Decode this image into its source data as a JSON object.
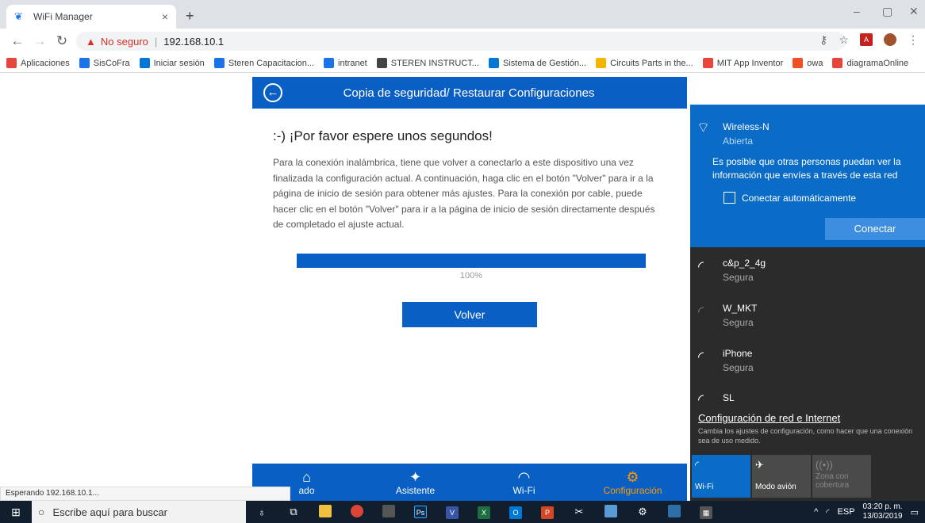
{
  "browser": {
    "tab_title": "WiFi Manager",
    "tab_close": "×",
    "new_tab": "+",
    "security_label": "No seguro",
    "url": "192.168.10.1",
    "window_controls": [
      "–",
      "▢",
      "✕"
    ]
  },
  "bookmarks": [
    {
      "label": "Aplicaciones",
      "color": "#e8453c"
    },
    {
      "label": "SisCoFra",
      "color": "#1a73e8"
    },
    {
      "label": "Iniciar sesión",
      "color": "#0078d4"
    },
    {
      "label": "Steren Capacitacion...",
      "color": "#1a73e8"
    },
    {
      "label": "intranet",
      "color": "#1a73e8"
    },
    {
      "label": "STEREN INSTRUCT...",
      "color": "#444"
    },
    {
      "label": "Sistema de Gestión...",
      "color": "#0078d4"
    },
    {
      "label": "Circuits Parts in the...",
      "color": "#f4b400"
    },
    {
      "label": "MIT App Inventor",
      "color": "#e8453c"
    },
    {
      "label": "owa",
      "color": "#f25022"
    },
    {
      "label": "diagramaOnline",
      "color": "#e8453c"
    }
  ],
  "page": {
    "header_title": "Copia de seguridad/ Restaurar Configuraciones",
    "wait_title": ":-) ¡Por favor espere unos segundos!",
    "wait_body": "Para la conexión inalámbrica, tiene que volver a conectarlo a este dispositivo una vez finalizada la configuración actual. A continuación, haga clic en el botón \"Volver\" para ir a la página de inicio de sesión para obtener más ajustes. Para la conexión por cable, puede hacer clic en el botón \"Volver\" para ir a la página de inicio de sesión directamente después de completado el ajuste actual.",
    "progress": 1.0,
    "progress_label": "100%",
    "back_button": "Volver",
    "status_text": "Esperando 192.168.10.1..."
  },
  "bottom_nav": [
    {
      "label": "ado",
      "icon": "home-icon",
      "active": false
    },
    {
      "label": "Asistente",
      "icon": "wand-icon",
      "active": false
    },
    {
      "label": "Wi-Fi",
      "icon": "wifi-icon",
      "active": false
    },
    {
      "label": "Configuración",
      "icon": "gear-icon",
      "active": true
    }
  ],
  "wifi": {
    "selected": {
      "name": "Wireless-N",
      "status": "Abierta",
      "info": "Es posible que otras personas puedan ver la información que envíes a través de esta red",
      "auto_connect": "Conectar automáticamente",
      "connect_button": "Conectar"
    },
    "networks": [
      {
        "name": "c&p_2_4g",
        "status": "Segura"
      },
      {
        "name": "W_MKT",
        "status": "Segura"
      },
      {
        "name": "iPhone",
        "status": "Segura"
      },
      {
        "name": "SL",
        "status": ""
      }
    ],
    "settings_link": "Configuración de red e Internet",
    "settings_desc": "Cambia los ajustes de configuración, como hacer que una conexión sea de uso medido.",
    "quick_actions": [
      {
        "label": "Wi-Fi",
        "active": true
      },
      {
        "label": "Modo avión",
        "active": false
      },
      {
        "label": "Zona con cobertura",
        "active": false
      }
    ]
  },
  "taskbar": {
    "search_placeholder": "Escribe aquí para buscar",
    "language": "ESP",
    "time": "03:20 p. m.",
    "date": "13/03/2019"
  }
}
